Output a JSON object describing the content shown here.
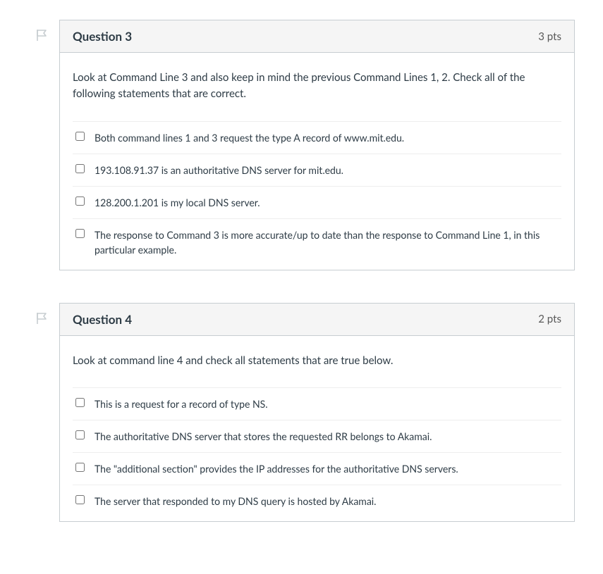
{
  "questions": [
    {
      "title": "Question 3",
      "points": "3 pts",
      "prompt": "Look at Command Line 3 and also keep in mind the previous Command Lines 1, 2. Check all of the following statements that are correct.",
      "options": [
        "Both command lines 1 and 3 request the type A record of www.mit.edu.",
        "193.108.91.37 is an authoritative DNS server for mit.edu.",
        "128.200.1.201 is my local DNS server.",
        "The response to Command 3 is more accurate/up to date than the response to Command Line 1, in this particular example."
      ]
    },
    {
      "title": "Question 4",
      "points": "2 pts",
      "prompt": "Look at command line 4 and check all statements that are true below.",
      "options": [
        "This is a request for a record of type NS.",
        "The authoritative DNS server that stores the requested RR belongs to Akamai.",
        "The \"additional section\" provides the IP addresses for the authoritative DNS servers.",
        "The server that responded to my DNS query is hosted by Akamai."
      ]
    }
  ]
}
